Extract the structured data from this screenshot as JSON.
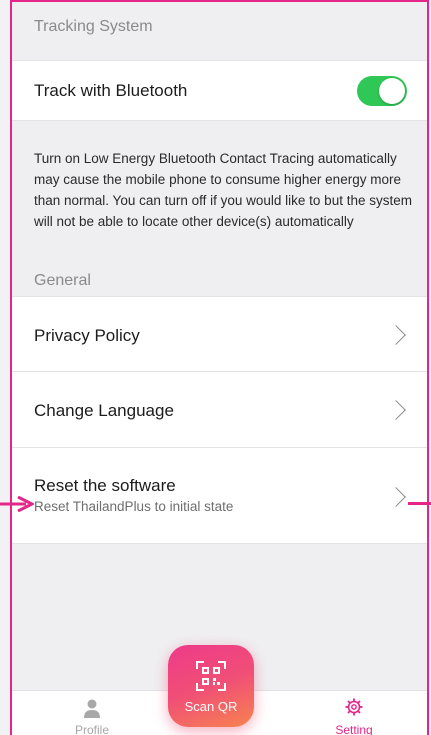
{
  "tracking": {
    "section_title": "Tracking System",
    "bluetooth_label": "Track with Bluetooth",
    "bluetooth_on": true,
    "description": "Turn on Low Energy Bluetooth Contact Tracing automatically may cause the mobile phone to consume higher energy more than normal. You can turn off if you would like to but the system will not be able to locate other device(s) automatically"
  },
  "general": {
    "section_title": "General",
    "items": [
      {
        "label": "Privacy Policy"
      },
      {
        "label": "Change Language"
      },
      {
        "label": "Reset the software",
        "sublabel": "Reset ThailandPlus to initial state"
      }
    ]
  },
  "tabbar": {
    "profile_label": "Profile",
    "scan_label": "Scan QR",
    "setting_label": "Setting",
    "active_color": "#e6258a",
    "inactive_color": "#a8a8a8"
  },
  "colors": {
    "accent": "#e6258a",
    "toggle_on": "#2fc756"
  }
}
